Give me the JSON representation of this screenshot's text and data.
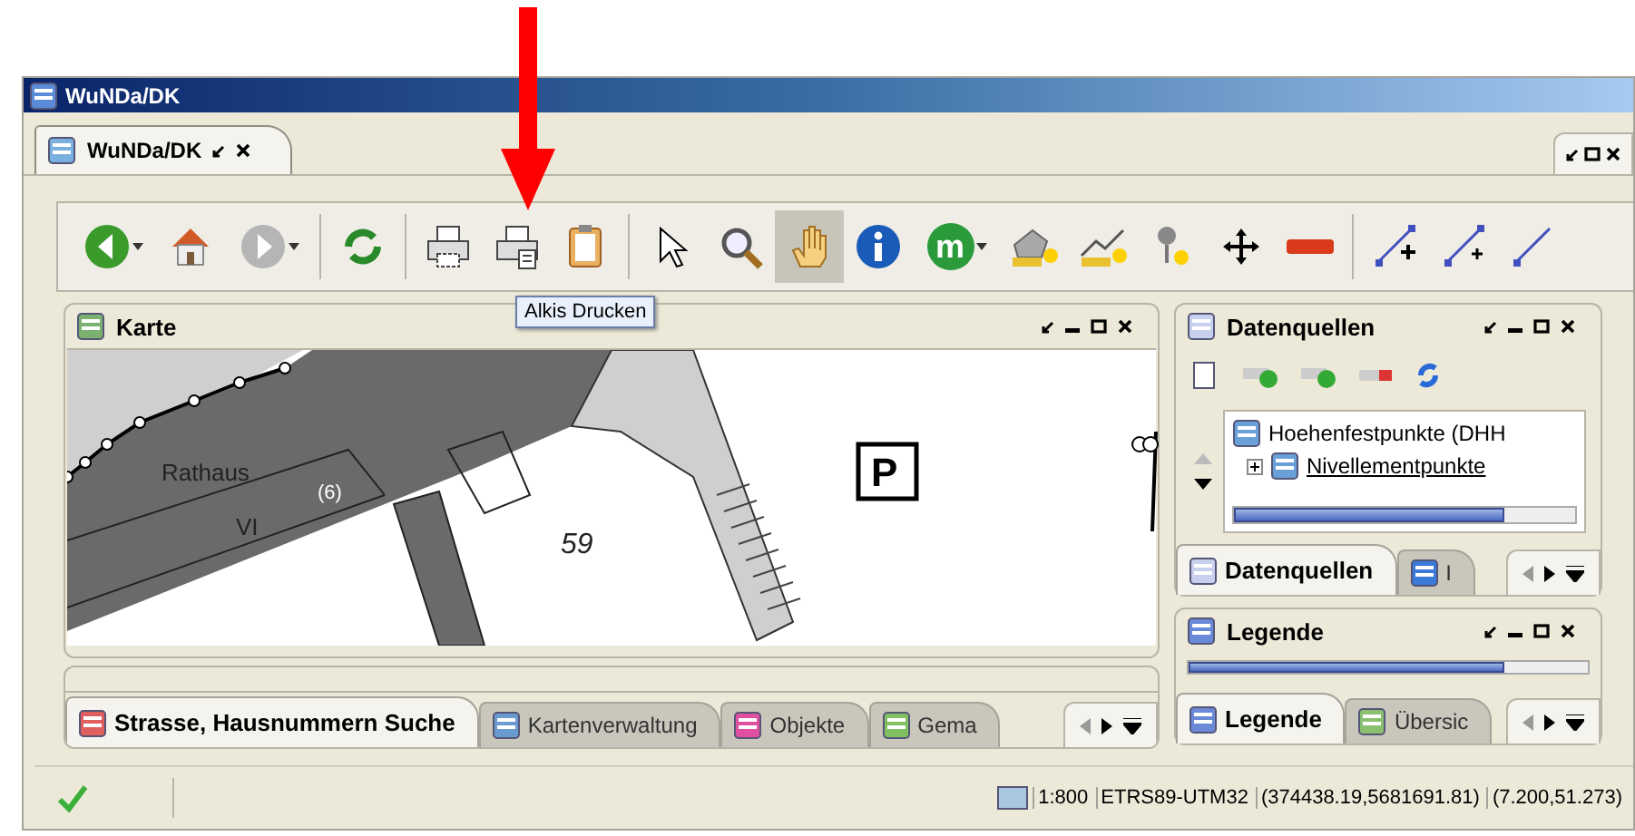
{
  "window": {
    "title": "WuNDa/DK"
  },
  "editor_tabs": [
    {
      "label": "WuNDa/DK",
      "selected": true
    }
  ],
  "toolbar": {
    "tooltip": "Alkis Drucken",
    "items": [
      {
        "kind": "button",
        "dropdown": true,
        "selected": false
      },
      {
        "kind": "button",
        "dropdown": false,
        "selected": false
      },
      {
        "kind": "button",
        "dropdown": true,
        "selected": false
      },
      {
        "kind": "separator"
      },
      {
        "kind": "button",
        "dropdown": false,
        "selected": false
      },
      {
        "kind": "separator"
      },
      {
        "kind": "button",
        "dropdown": false,
        "selected": false
      },
      {
        "kind": "button",
        "dropdown": false,
        "selected": false
      },
      {
        "kind": "button",
        "dropdown": false,
        "selected": false
      },
      {
        "kind": "separator"
      },
      {
        "kind": "button",
        "dropdown": false,
        "selected": false
      },
      {
        "kind": "button",
        "dropdown": false,
        "selected": false
      },
      {
        "kind": "button",
        "dropdown": false,
        "selected": true
      },
      {
        "kind": "button",
        "dropdown": false,
        "selected": false
      },
      {
        "kind": "button",
        "dropdown": true,
        "selected": false,
        "text": "m"
      },
      {
        "kind": "button",
        "dropdown": false,
        "selected": false
      },
      {
        "kind": "button",
        "dropdown": false,
        "selected": false
      },
      {
        "kind": "button",
        "dropdown": false,
        "selected": false
      },
      {
        "kind": "button",
        "dropdown": false,
        "selected": false
      },
      {
        "kind": "button",
        "dropdown": false,
        "selected": false
      },
      {
        "kind": "separator"
      },
      {
        "kind": "button",
        "dropdown": false,
        "selected": false
      },
      {
        "kind": "button",
        "dropdown": false,
        "selected": false
      },
      {
        "kind": "button",
        "dropdown": false,
        "selected": false
      }
    ]
  },
  "map_panel": {
    "title": "Karte",
    "labels": [
      "Rathaus",
      "(6)",
      "VI",
      "59",
      "P"
    ]
  },
  "bottom_tabs": [
    {
      "label": "Strasse, Hausnummern Suche",
      "selected": true
    },
    {
      "label": "Kartenverwaltung",
      "selected": false
    },
    {
      "label": "Objekte",
      "selected": false
    },
    {
      "label": "Gema",
      "selected": false
    }
  ],
  "datasources": {
    "title": "Datenquellen",
    "tree": [
      {
        "label": "Hoehenfestpunkte (DHH",
        "children": [
          {
            "label": "Nivellementpunkte",
            "expanded": false
          }
        ]
      }
    ],
    "tabs": [
      {
        "label": "Datenquellen",
        "selected": true
      },
      {
        "label": "I",
        "selected": false
      }
    ]
  },
  "legend": {
    "title": "Legende",
    "tabs": [
      {
        "label": "Legende",
        "selected": true
      },
      {
        "label": "Übersic",
        "selected": false
      }
    ]
  },
  "status_bar": {
    "ok": true,
    "fields": [
      "1:800",
      "ETRS89-UTM32",
      "(374438.19,5681691.81)",
      "(7.200,51.273)"
    ]
  }
}
